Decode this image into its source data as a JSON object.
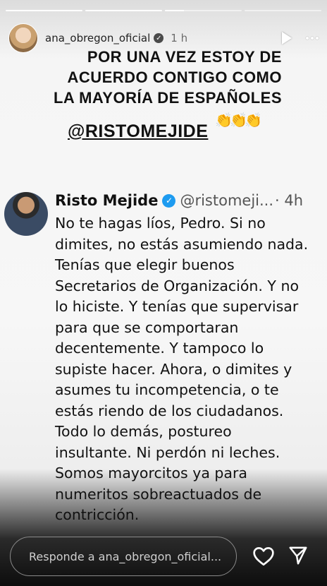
{
  "story": {
    "progress": [
      1.0,
      1.0,
      0.25,
      0.0
    ],
    "username": "ana_obregon_oficial",
    "time": "1 h",
    "caption_lines": [
      "POR UNA VEZ ESTOY DE",
      "ACUERDO CONTIGO COMO",
      "LA MAYORÍA DE ESPAÑOLES"
    ],
    "mention": "@RISTOMEJIDE",
    "emoji": "👏👏👏"
  },
  "tweet": {
    "name": "Risto Mejide",
    "handle": "@ristomeji...",
    "time": "· 4h",
    "lines": [
      "No te hagas líos, Pedro. Si no",
      "dimites, no estás asumiendo nada.",
      "Tenías que elegir buenos",
      "Secretarios de Organización. Y no",
      "lo hiciste. Y tenías que supervisar",
      "para que se comportaran",
      "decentemente. Y tampoco lo",
      "supiste hacer. Ahora, o dimites y",
      "asumes tu incompetencia, o te",
      "estás riendo de los ciudadanos.",
      "Todo lo demás, postureo",
      "insultante. Ni perdón ni leches.",
      "Somos mayorcitos ya para",
      "numeritos sobreactuados de",
      "contricción."
    ]
  },
  "reply": {
    "placeholder": "Responde a ana_obregon_oficial..."
  },
  "icons": {
    "verified": "verified-badge-icon",
    "play": "play-icon",
    "more": "more-options-icon",
    "like": "heart-icon",
    "send": "send-icon"
  },
  "colors": {
    "twitter_verified": "#1d9bf0",
    "text": "#111111"
  }
}
